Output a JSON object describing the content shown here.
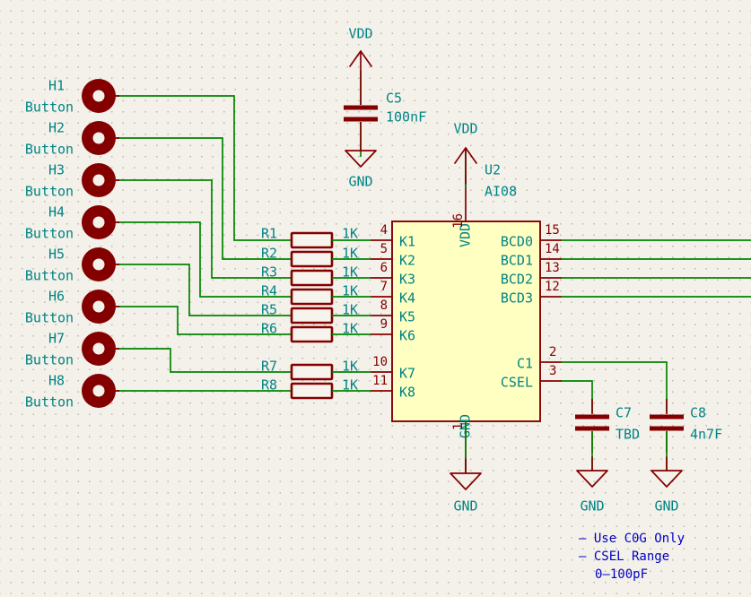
{
  "sheet": {
    "background": "#f3f1e9",
    "wire_color": "#008400",
    "component_color": "#840000",
    "label_color": "#008484",
    "note_color": "#0000c8",
    "ic_fill": "#ffffc2"
  },
  "buttons": [
    {
      "ref": "H1",
      "value": "Button"
    },
    {
      "ref": "H2",
      "value": "Button"
    },
    {
      "ref": "H3",
      "value": "Button"
    },
    {
      "ref": "H4",
      "value": "Button"
    },
    {
      "ref": "H5",
      "value": "Button"
    },
    {
      "ref": "H6",
      "value": "Button"
    },
    {
      "ref": "H7",
      "value": "Button"
    },
    {
      "ref": "H8",
      "value": "Button"
    }
  ],
  "resistors": [
    {
      "ref": "R1",
      "value": "1K"
    },
    {
      "ref": "R2",
      "value": "1K"
    },
    {
      "ref": "R3",
      "value": "1K"
    },
    {
      "ref": "R4",
      "value": "1K"
    },
    {
      "ref": "R5",
      "value": "1K"
    },
    {
      "ref": "R6",
      "value": "1K"
    },
    {
      "ref": "R7",
      "value": "1K"
    },
    {
      "ref": "R8",
      "value": "1K"
    }
  ],
  "ic": {
    "ref": "U2",
    "value": "AI08",
    "pins_left": [
      {
        "num": "4",
        "name": "K1"
      },
      {
        "num": "5",
        "name": "K2"
      },
      {
        "num": "6",
        "name": "K3"
      },
      {
        "num": "7",
        "name": "K4"
      },
      {
        "num": "8",
        "name": "K5"
      },
      {
        "num": "9",
        "name": "K6"
      },
      {
        "num": "10",
        "name": "K7"
      },
      {
        "num": "11",
        "name": "K8"
      }
    ],
    "pins_right_top": [
      {
        "num": "15",
        "name": "BCD0"
      },
      {
        "num": "14",
        "name": "BCD1"
      },
      {
        "num": "13",
        "name": "BCD2"
      },
      {
        "num": "12",
        "name": "BCD3"
      }
    ],
    "pins_right_bottom": [
      {
        "num": "2",
        "name": "C1"
      },
      {
        "num": "3",
        "name": "CSEL"
      }
    ],
    "pin_top": {
      "num": "16",
      "name": "VDD"
    },
    "pin_bottom": {
      "num": "1",
      "name": "GND"
    }
  },
  "capacitors": [
    {
      "ref": "C5",
      "value": "100nF"
    },
    {
      "ref": "C7",
      "value": "TBD"
    },
    {
      "ref": "C8",
      "value": "4n7F"
    }
  ],
  "power_symbols": [
    {
      "label": "VDD",
      "kind": "vdd-arrow"
    },
    {
      "label": "GND",
      "kind": "gnd-triangle"
    },
    {
      "label": "VDD",
      "kind": "vdd-arrow"
    },
    {
      "label": "GND",
      "kind": "gnd-triangle"
    },
    {
      "label": "GND",
      "kind": "gnd-triangle"
    },
    {
      "label": "GND",
      "kind": "gnd-triangle"
    }
  ],
  "notes": {
    "line1": "– Use C0G Only",
    "line2": "– CSEL Range",
    "line3": "0–100pF"
  }
}
